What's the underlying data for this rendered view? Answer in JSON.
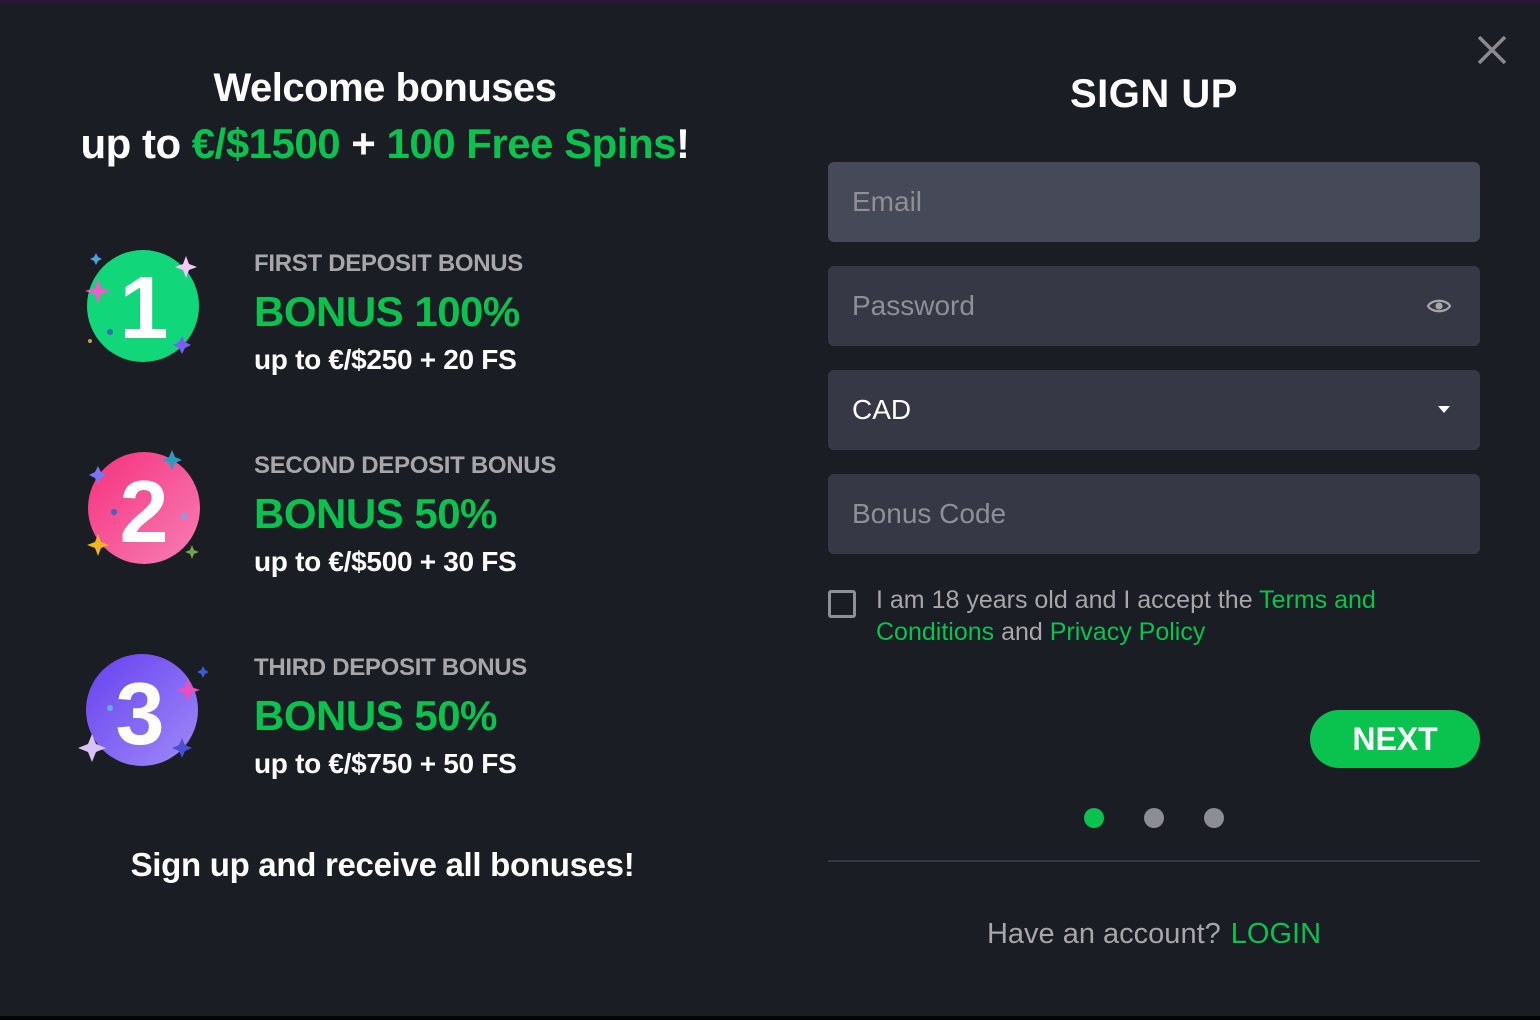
{
  "promo": {
    "title_line1": "Welcome bonuses",
    "title_line2_prefix": "up to ",
    "title_amount": "€/$1500",
    "title_plus": " + ",
    "title_spins": "100 Free Spins",
    "title_suffix": "!",
    "bonuses": [
      {
        "number": "1",
        "label": "FIRST DEPOSIT BONUS",
        "percent": "BONUS 100%",
        "detail": "up to €/$250 + 20 FS",
        "badge_color": "#12d77a"
      },
      {
        "number": "2",
        "label": "SECOND DEPOSIT BONUS",
        "percent": "BONUS 50%",
        "detail": "up to €/$500 + 30 FS",
        "badge_color": "#f0438a"
      },
      {
        "number": "3",
        "label": "THIRD DEPOSIT BONUS",
        "percent": "BONUS 50%",
        "detail": "up to €/$750 + 50 FS",
        "badge_color": "#7b5cf5"
      }
    ],
    "footer": "Sign up and receive all bonuses!"
  },
  "signup": {
    "title": "SIGN UP",
    "close_icon": "close-icon",
    "email": {
      "placeholder": "Email",
      "value": ""
    },
    "password": {
      "placeholder": "Password",
      "value": "",
      "toggle_icon": "eye-icon"
    },
    "currency": {
      "selected": "CAD"
    },
    "bonus_code": {
      "placeholder": "Bonus Code",
      "value": ""
    },
    "terms": {
      "checked": false,
      "text_prefix": "I am 18 years old and I accept the ",
      "terms_link": "Terms and Conditions",
      "text_middle": " and ",
      "privacy_link": "Privacy Policy"
    },
    "next_label": "NEXT",
    "steps": {
      "total": 3,
      "current": 1
    },
    "have_account_text": "Have an account?",
    "login_label": "LOGIN"
  },
  "colors": {
    "accent": "#0ac34f",
    "background": "#1b1d24",
    "field": "#363845",
    "field_focused": "#464957",
    "muted_text": "#a6a6ab"
  }
}
